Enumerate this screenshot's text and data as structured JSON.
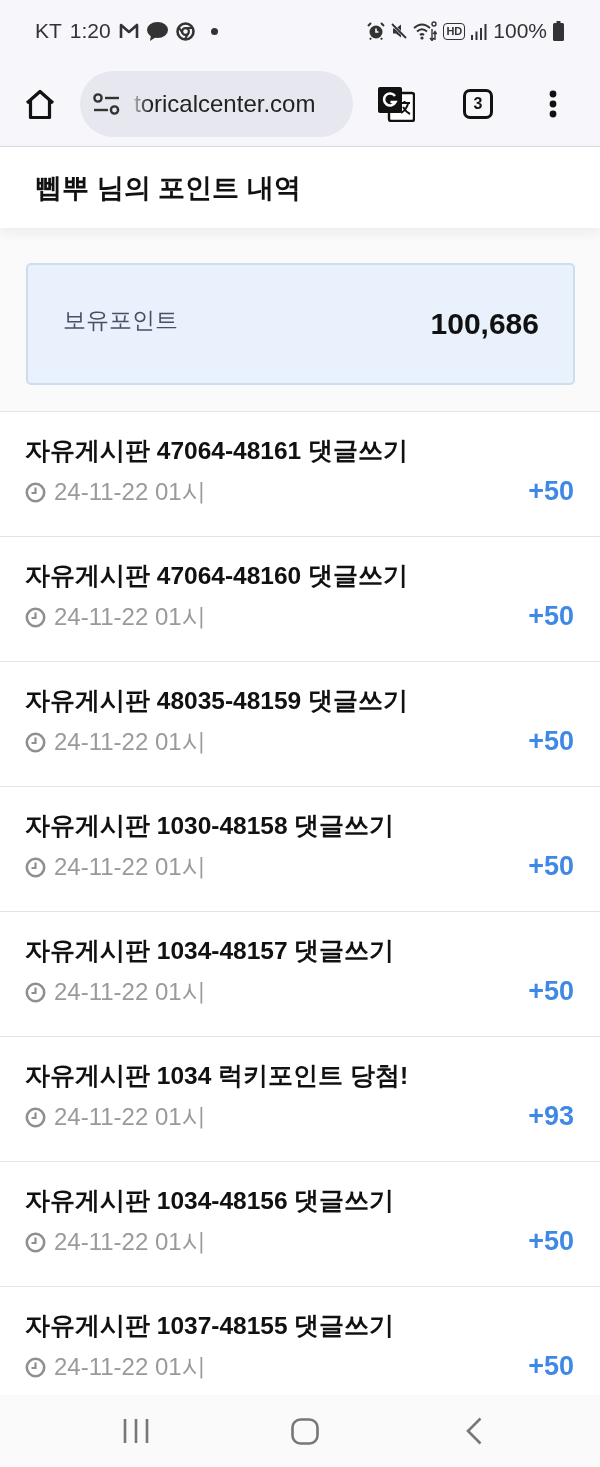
{
  "status_bar": {
    "carrier": "KT",
    "time": "1:20",
    "hd_label": "HD",
    "battery": "100%"
  },
  "browser": {
    "url": "toricalcenter.com",
    "tab_count": "3"
  },
  "header": {
    "title": "뻽뿌 님의 포인트 내역"
  },
  "balance": {
    "label": "보유포인트",
    "value": "100,686"
  },
  "entries": [
    {
      "title": "자유게시판 47064-48161 댓글쓰기",
      "date": "24-11-22 01시",
      "points": "+50"
    },
    {
      "title": "자유게시판 47064-48160 댓글쓰기",
      "date": "24-11-22 01시",
      "points": "+50"
    },
    {
      "title": "자유게시판 48035-48159 댓글쓰기",
      "date": "24-11-22 01시",
      "points": "+50"
    },
    {
      "title": "자유게시판 1030-48158 댓글쓰기",
      "date": "24-11-22 01시",
      "points": "+50"
    },
    {
      "title": "자유게시판 1034-48157 댓글쓰기",
      "date": "24-11-22 01시",
      "points": "+50"
    },
    {
      "title": "자유게시판 1034 럭키포인트 당첨!",
      "date": "24-11-22 01시",
      "points": "+93"
    },
    {
      "title": "자유게시판 1034-48156 댓글쓰기",
      "date": "24-11-22 01시",
      "points": "+50"
    },
    {
      "title": "자유게시판 1037-48155 댓글쓰기",
      "date": "24-11-22 01시",
      "points": "+50"
    }
  ]
}
